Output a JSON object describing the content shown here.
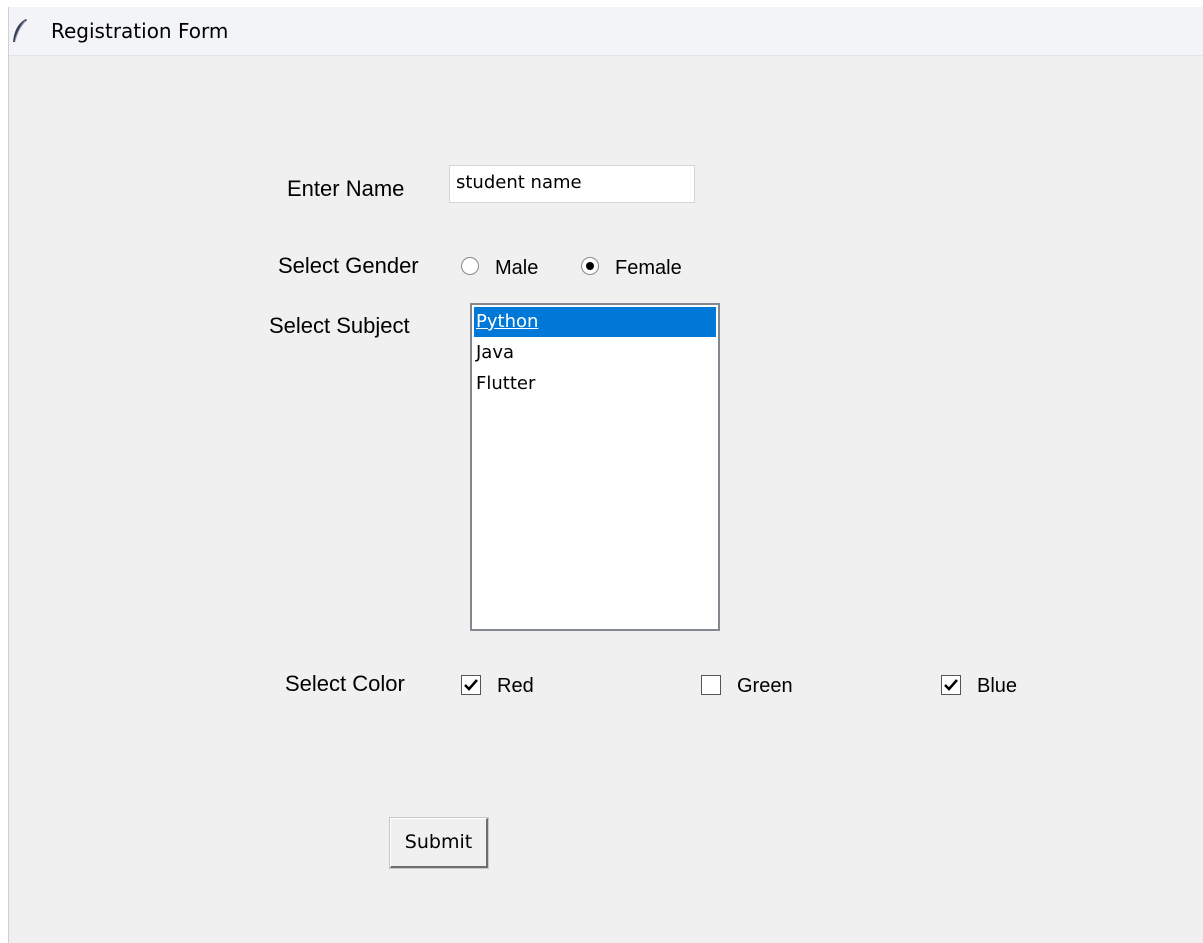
{
  "window": {
    "title": "Registration Form"
  },
  "form": {
    "name_label": "Enter Name",
    "name_value": "student name",
    "gender_label": "Select Gender",
    "gender_options": [
      {
        "label": "Male",
        "selected": false
      },
      {
        "label": "Female",
        "selected": true
      }
    ],
    "subject_label": "Select Subject",
    "subjects": [
      {
        "label": "Python",
        "selected": true
      },
      {
        "label": "Java",
        "selected": false
      },
      {
        "label": "Flutter",
        "selected": false
      }
    ],
    "color_label": "Select Color",
    "colors": [
      {
        "label": "Red",
        "checked": true
      },
      {
        "label": "Green",
        "checked": false
      },
      {
        "label": "Blue",
        "checked": true
      }
    ],
    "submit_label": "Submit"
  },
  "theme": {
    "selection": "#0078d7",
    "window_bg": "#f0f0f0"
  }
}
